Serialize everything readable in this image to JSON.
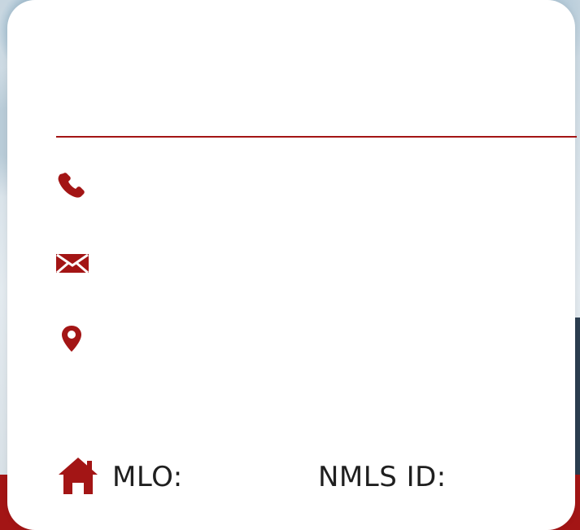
{
  "colors": {
    "accent": "#a31515",
    "card_background": "#ffffff"
  },
  "icons": {
    "phone": "phone-icon",
    "email": "envelope-icon",
    "location": "map-pin-icon",
    "home": "home-icon"
  },
  "contact": {
    "phone_value": "",
    "email_value": "",
    "location_value": ""
  },
  "footer": {
    "mlo_label": "MLO:",
    "nmls_label": "NMLS ID:"
  }
}
